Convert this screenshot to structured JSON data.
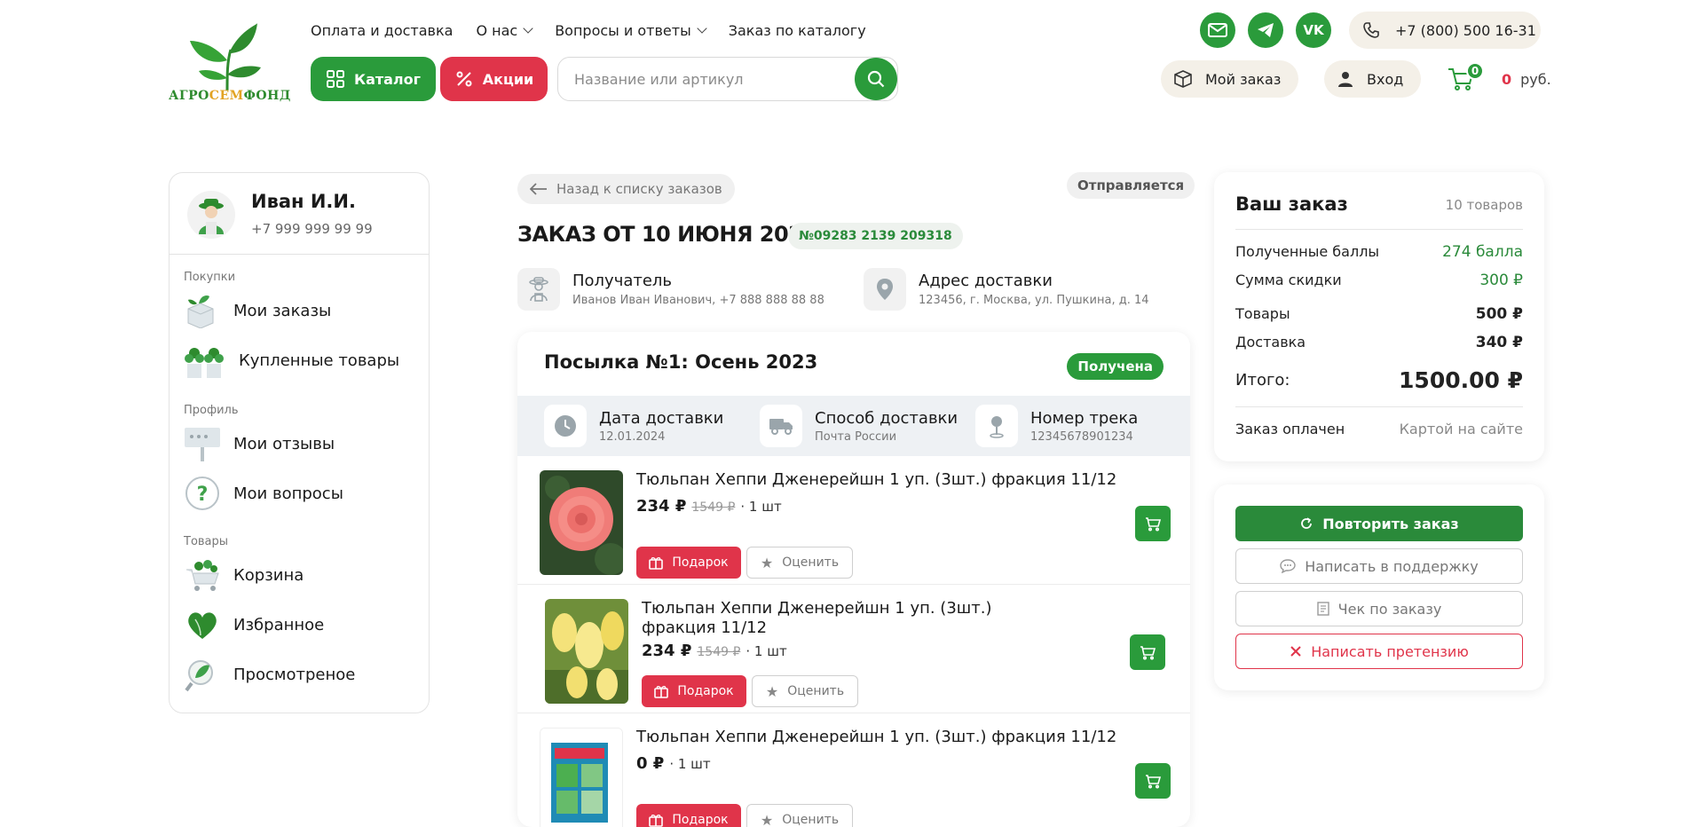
{
  "header": {
    "logo_text_a": "АГРО",
    "logo_text_b": "СЕМ",
    "logo_text_c": "ФОНД",
    "nav": [
      "Оплата и доставка",
      "О нас",
      "Вопросы и ответы",
      "Заказ по каталогу"
    ],
    "catalog_label": "Каталог",
    "promo_label": "Акции",
    "search_placeholder": "Название или артикул",
    "social_vk": "VK",
    "phone": "+7 (800) 500 16-31",
    "my_order_label": "Мой заказ",
    "login_label": "Вход",
    "cart_count": "0",
    "cart_sum": "0",
    "cart_currency": "руб."
  },
  "profile": {
    "name": "Иван И.И.",
    "phone": "+7 999 999 99 99",
    "sections": {
      "purchases": "Покупки",
      "profile": "Профиль",
      "goods": "Товары"
    },
    "items": {
      "orders": "Мои заказы",
      "bought": "Купленные товары",
      "reviews": "Мои отзывы",
      "questions": "Мои вопросы",
      "cart": "Корзина",
      "favorites": "Избранное",
      "viewed": "Просмотреное"
    }
  },
  "order": {
    "back_label": "Назад к списку заказов",
    "status": "Отправляется",
    "title": "ЗАКАЗ ОТ 10 ИЮНЯ 2024",
    "number": "№09283 2139 209318",
    "recipient_label": "Получатель",
    "recipient_value": "Иванов Иван Иванович, +7 888 888 88 88",
    "address_label": "Адрес доставки",
    "address_value": "123456, г. Москва, ул. Пушкина, д. 14"
  },
  "parcel": {
    "title": "Посылка №1: Осень 2023",
    "status": "Получена",
    "delivery_date_label": "Дата доставки",
    "delivery_date_value": "12.01.2024",
    "delivery_method_label": "Способ доставки",
    "delivery_method_value": "Почта России",
    "track_label": "Номер трека",
    "track_value": "12345678901234",
    "gift_label": "Подарок",
    "rate_label": "Оценить",
    "products": [
      {
        "name": "Тюльпан Хеппи Дженерейшн 1 уп. (3шт.) фракция 11/12",
        "price": "234 ₽",
        "old_price": "1549 ₽",
        "qty": "· 1 шт"
      },
      {
        "name": "Тюльпан Хеппи Дженерейшн 1 уп. (3шт.) фракция 11/12",
        "price": "234 ₽",
        "old_price": "1549 ₽",
        "qty": "· 1 шт"
      },
      {
        "name": "Тюльпан Хеппи Дженерейшн 1 уп. (3шт.) фракция 11/12",
        "price": "0 ₽",
        "old_price": "",
        "qty": "· 1 шт"
      }
    ]
  },
  "summary": {
    "title": "Ваш заказ",
    "count": "10 товаров",
    "points_label": "Полученные баллы",
    "points_value": "274 балла",
    "discount_label": "Сумма скидки",
    "discount_value": "300 ₽",
    "goods_label": "Товары",
    "goods_value": "500 ₽",
    "delivery_label": "Доставка",
    "delivery_value": "340 ₽",
    "total_label": "Итого:",
    "total_value": "1500.00 ₽",
    "paid_label": "Заказ оплачен",
    "paid_value": "Картой на сайте"
  },
  "actions": {
    "repeat": "Повторить заказ",
    "support": "Написать в поддержку",
    "receipt": "Чек по заказу",
    "claim": "Написать претензию"
  },
  "colors": {
    "green": "#2a9b3b",
    "red": "#e0344a",
    "beige": "#f4f0e8"
  }
}
